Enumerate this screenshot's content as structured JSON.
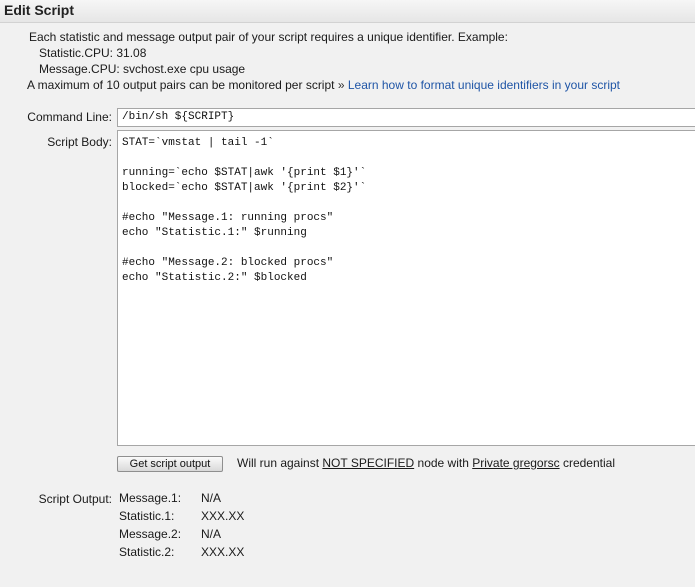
{
  "header": {
    "title": "Edit Script"
  },
  "help": {
    "intro": "Each statistic and message output pair of your script requires a unique identifier. Example:",
    "example_statistic": "Statistic.CPU: 31.08",
    "example_message": "Message.CPU: svchost.exe cpu usage",
    "max_text": "A maximum of 10 output pairs can be monitored per script",
    "raquo": "»",
    "learn_link": "Learn how to format unique identifiers in your script"
  },
  "form": {
    "command_line_label": "Command Line:",
    "command_line_value": "/bin/sh ${SCRIPT}",
    "script_body_label": "Script Body:",
    "script_body_value": "STAT=`vmstat | tail -1`\n\nrunning=`echo $STAT|awk '{print $1}'`\nblocked=`echo $STAT|awk '{print $2}'`\n\n#echo \"Message.1: running procs\"\necho \"Statistic.1:\" $running\n\n#echo \"Message.2: blocked procs\"\necho \"Statistic.2:\" $blocked",
    "get_output_button": "Get script output"
  },
  "run_info": {
    "prefix": "Will run against",
    "node": "NOT SPECIFIED",
    "middle": "node with",
    "credential": "Private gregorsc",
    "suffix": "credential"
  },
  "output": {
    "label": "Script Output:",
    "rows": [
      {
        "key": "Message.1:",
        "value": "N/A"
      },
      {
        "key": "Statistic.1:",
        "value": "XXX.XX"
      },
      {
        "key": "Message.2:",
        "value": "N/A"
      },
      {
        "key": "Statistic.2:",
        "value": "XXX.XX"
      }
    ]
  }
}
